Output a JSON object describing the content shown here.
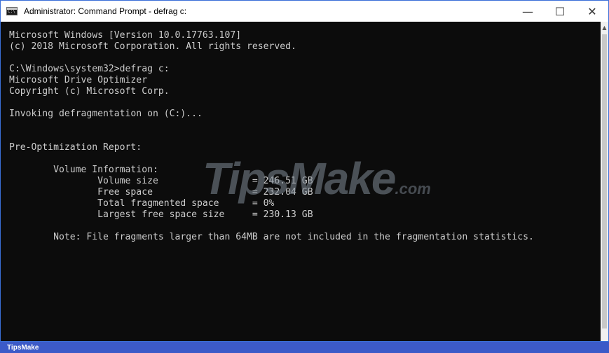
{
  "window": {
    "title": "Administrator: Command Prompt - defrag  c:",
    "icon": "cmd-icon",
    "controls": {
      "minimize": "—",
      "maximize": "☐",
      "close": "✕"
    }
  },
  "console": {
    "output": "Microsoft Windows [Version 10.0.17763.107]\n(c) 2018 Microsoft Corporation. All rights reserved.\n\nC:\\Windows\\system32>defrag c:\nMicrosoft Drive Optimizer\nCopyright (c) Microsoft Corp.\n\nInvoking defragmentation on (C:)...\n\n\nPre-Optimization Report:\n\n        Volume Information:\n                Volume size                 = 246.51 GB\n                Free space                  = 232.04 GB\n                Total fragmented space      = 0%\n                Largest free space size     = 230.13 GB\n\n        Note: File fragments larger than 64MB are not included in the fragmentation statistics."
  },
  "watermark": {
    "text": "TipsMake",
    "suffix": ".com"
  },
  "footer": {
    "label": "TipsMake"
  },
  "colors": {
    "console_bg": "#0c0c0c",
    "console_text": "#cccccc",
    "accent": "#3c5ac8"
  }
}
